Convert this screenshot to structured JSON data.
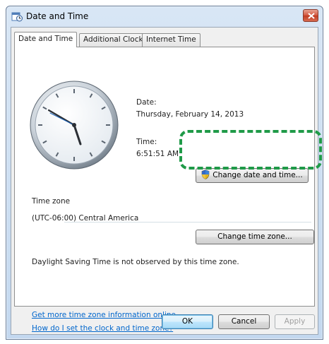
{
  "window": {
    "title": "Date and Time"
  },
  "tabs": [
    {
      "label": "Date and Time",
      "active": true
    },
    {
      "label": "Additional Clocks",
      "active": false
    },
    {
      "label": "Internet Time",
      "active": false
    }
  ],
  "date": {
    "label": "Date:",
    "value": "Thursday, February 14, 2013"
  },
  "time": {
    "label": "Time:",
    "value": "6:51:51 AM"
  },
  "buttons": {
    "change_date_time": "Change date and time...",
    "change_time_zone": "Change time zone...",
    "ok": "OK",
    "cancel": "Cancel",
    "apply": "Apply"
  },
  "time_zone": {
    "heading": "Time zone",
    "value": "(UTC-06:00) Central America",
    "dst_note": "Daylight Saving Time is not observed by this time zone."
  },
  "links": {
    "more_info": "Get more time zone information online",
    "how_to_set": "How do I set the clock and time zone?"
  },
  "colors": {
    "highlight": "#1f9a48",
    "link": "#0066cc"
  }
}
